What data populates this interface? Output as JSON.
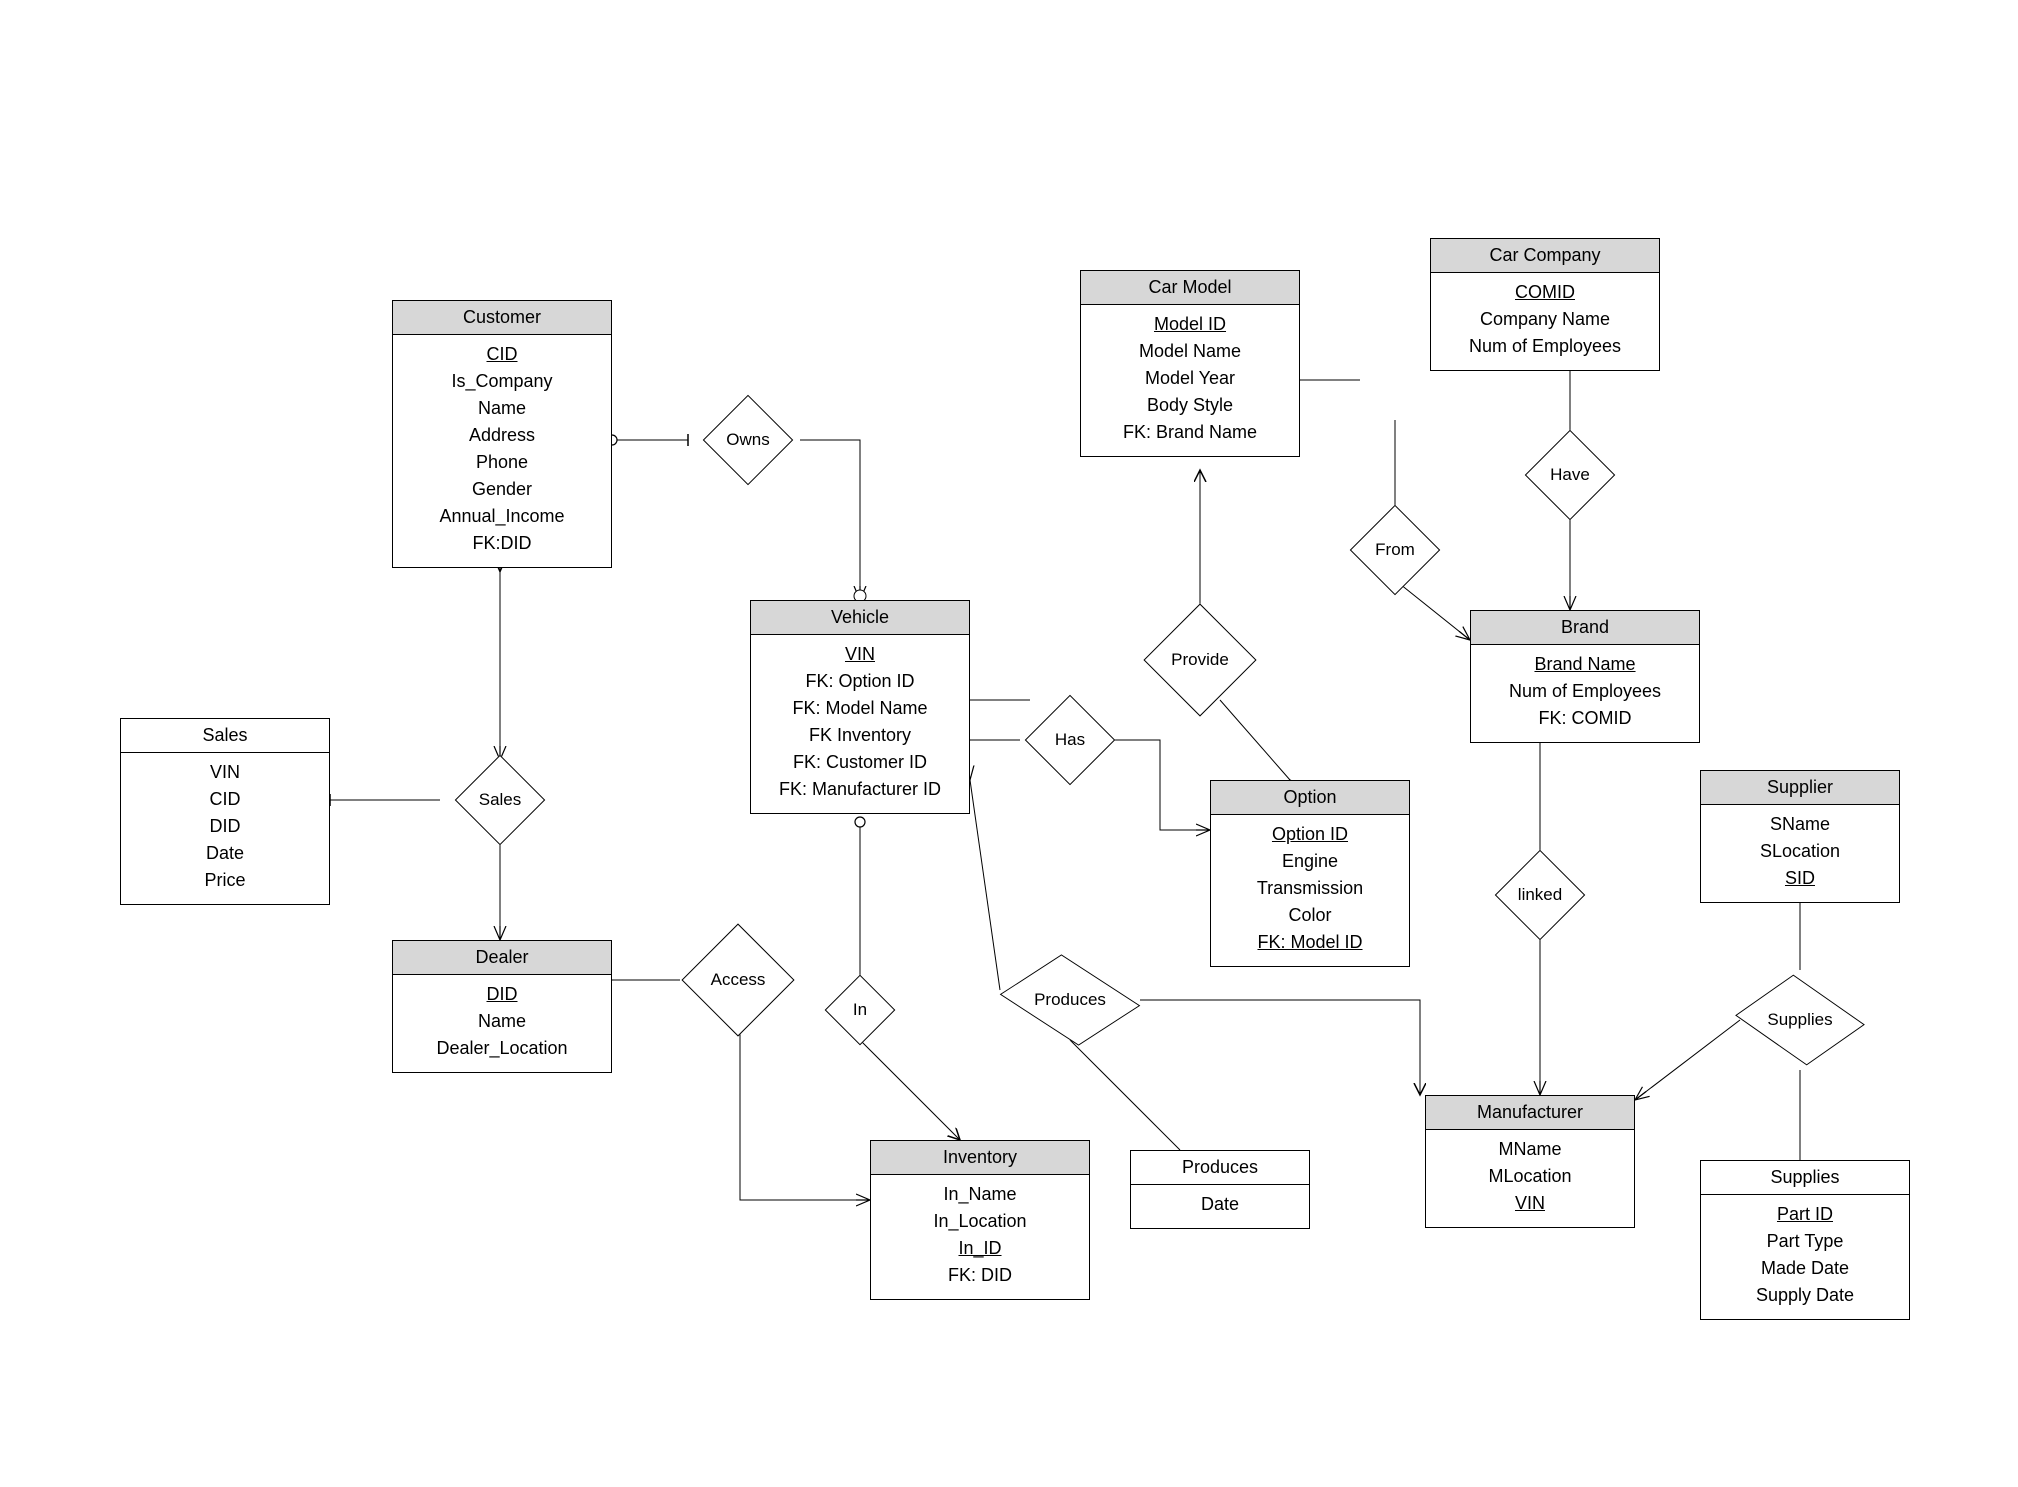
{
  "entities": {
    "customer": {
      "title": "Customer",
      "attrs": [
        "CID",
        "Is_Company",
        "Name",
        "Address",
        "Phone",
        "Gender",
        "Annual_Income",
        "FK:DID"
      ],
      "pk": [
        "CID"
      ]
    },
    "sales": {
      "title": "Sales",
      "attrs": [
        "VIN",
        "CID",
        "DID",
        "Date",
        "Price"
      ],
      "pk": []
    },
    "dealer": {
      "title": "Dealer",
      "attrs": [
        "DID",
        "Name",
        "Dealer_Location"
      ],
      "pk": [
        "DID"
      ]
    },
    "vehicle": {
      "title": "Vehicle",
      "attrs": [
        "VIN",
        "FK: Option ID",
        "FK: Model Name",
        "FK Inventory",
        "FK: Customer ID",
        "FK: Manufacturer ID"
      ],
      "pk": [
        "VIN"
      ]
    },
    "inventory": {
      "title": "Inventory",
      "attrs": [
        "In_Name",
        "In_Location",
        "In_ID",
        "FK: DID"
      ],
      "pk": [
        "In_ID"
      ]
    },
    "car_model": {
      "title": "Car Model",
      "attrs": [
        "Model ID",
        "Model Name",
        "Model Year",
        "Body Style",
        "FK: Brand Name"
      ],
      "pk": [
        "Model ID"
      ]
    },
    "option": {
      "title": "Option",
      "attrs": [
        "Option ID",
        "Engine",
        "Transmission",
        "Color",
        "FK: Model ID"
      ],
      "pk": [
        "Option ID",
        "FK: Model ID"
      ]
    },
    "car_company": {
      "title": "Car Company",
      "attrs": [
        "COMID",
        "Company Name",
        "Num of Employees"
      ],
      "pk": [
        "COMID"
      ]
    },
    "brand": {
      "title": "Brand",
      "attrs": [
        "Brand Name",
        "Num of Employees",
        "FK: COMID"
      ],
      "pk": [
        "Brand Name"
      ]
    },
    "supplier": {
      "title": "Supplier",
      "attrs": [
        "SName",
        "SLocation",
        "SID"
      ],
      "pk": [
        "SID"
      ]
    },
    "manufacturer": {
      "title": "Manufacturer",
      "attrs": [
        "MName",
        "MLocation",
        "VIN"
      ],
      "pk": [
        "VIN"
      ]
    },
    "produces_assoc": {
      "title": "Produces",
      "attrs": [
        "Date"
      ],
      "pk": []
    },
    "supplies_assoc": {
      "title": "Supplies",
      "attrs": [
        "Part ID",
        "Part Type",
        "Made Date",
        "Supply Date"
      ],
      "pk": [
        "Part ID"
      ]
    }
  },
  "relationships": {
    "owns": "Owns",
    "sales": "Sales",
    "access": "Access",
    "in": "In",
    "has": "Has",
    "provide": "Provide",
    "produces": "Produces",
    "from": "From",
    "have": "Have",
    "linked": "linked",
    "supplies": "Supplies"
  }
}
